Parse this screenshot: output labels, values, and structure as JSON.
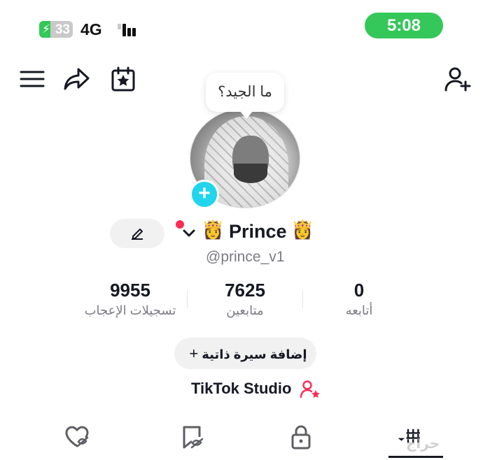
{
  "status_bar": {
    "battery_level": "33",
    "battery_icon": "charging-bolt-icon",
    "network": "4G",
    "time": "5:08",
    "accent": "#34c759"
  },
  "header": {
    "menu_icon": "hamburger-menu-icon",
    "share_icon": "share-arrow-icon",
    "calendar_icon": "calendar-star-icon",
    "add_friend_icon": "add-user-icon"
  },
  "profile": {
    "bubble_text": "ما الجيد؟",
    "crown_left": "👸",
    "crown_right": "👸",
    "name": "Prince",
    "handle": "@prince_v1",
    "edit_icon": "pencil-icon",
    "notification_color": "#fe2c55",
    "add_badge": "+"
  },
  "stats": [
    {
      "value": "9955",
      "label": "تسجيلات الإعجاب"
    },
    {
      "value": "7625",
      "label": "متابعين"
    },
    {
      "value": "0",
      "label": "أتابعه"
    }
  ],
  "bio_button": {
    "label": "إضافة سيرة ذاتية",
    "plus": "+"
  },
  "studio": {
    "label": "TikTok Studio",
    "icon": "user-star-icon"
  },
  "tabs": [
    {
      "name": "liked",
      "icon": "heart-hidden-icon"
    },
    {
      "name": "favorites",
      "icon": "bookmark-hidden-icon"
    },
    {
      "name": "private",
      "icon": "lock-icon"
    },
    {
      "name": "videos",
      "icon": "grid-bars-icon",
      "active": true
    }
  ],
  "watermark": "حراج"
}
